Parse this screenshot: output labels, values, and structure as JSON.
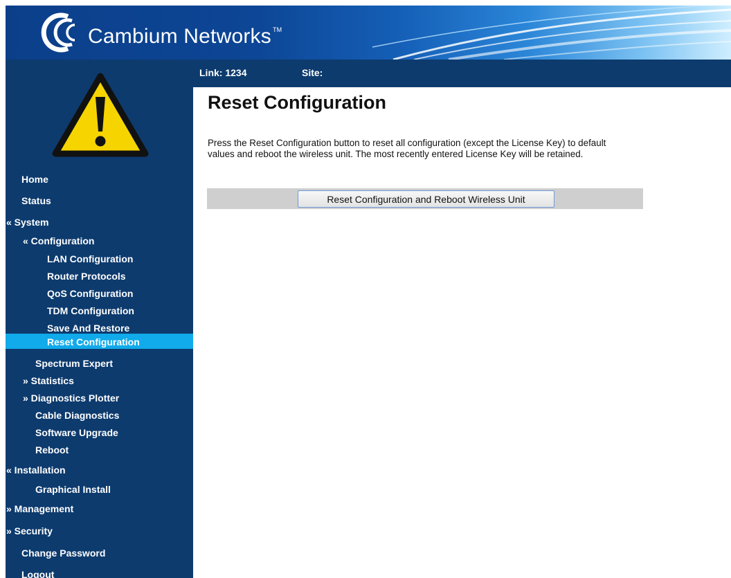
{
  "banner": {
    "brand": "Cambium Networks",
    "trademark": "TM",
    "logo_icon": "cambium-c-logo",
    "colors": {
      "dark_blue": "#0d3b6e",
      "highlight": "#11aaea"
    }
  },
  "linkbar": {
    "link": "Link: 1234",
    "site": "Site:"
  },
  "sidebar": {
    "alert_icon": "warning-icon",
    "items": [
      {
        "label": "Home"
      },
      {
        "label": "Status"
      },
      {
        "label": "« System"
      },
      {
        "label": "« Configuration"
      },
      {
        "label": "LAN Configuration"
      },
      {
        "label": "Router Protocols"
      },
      {
        "label": "QoS Configuration"
      },
      {
        "label": "TDM Configuration"
      },
      {
        "label": "Save And Restore"
      },
      {
        "label": "Reset Configuration",
        "selected": true
      },
      {
        "label": "Spectrum Expert"
      },
      {
        "label": "» Statistics"
      },
      {
        "label": "» Diagnostics Plotter"
      },
      {
        "label": "Cable Diagnostics"
      },
      {
        "label": "Software Upgrade"
      },
      {
        "label": "Reboot"
      },
      {
        "label": "« Installation"
      },
      {
        "label": "Graphical Install"
      },
      {
        "label": "» Management"
      },
      {
        "label": "» Security"
      },
      {
        "label": "Change Password"
      },
      {
        "label": "Logout"
      }
    ]
  },
  "main": {
    "title": "Reset Configuration",
    "description": "Press the Reset Configuration button to reset all configuration (except the License Key) to default values and reboot the wireless unit. The most recently entered License Key will be retained.",
    "button_label": "Reset Configuration and Reboot Wireless Unit"
  }
}
